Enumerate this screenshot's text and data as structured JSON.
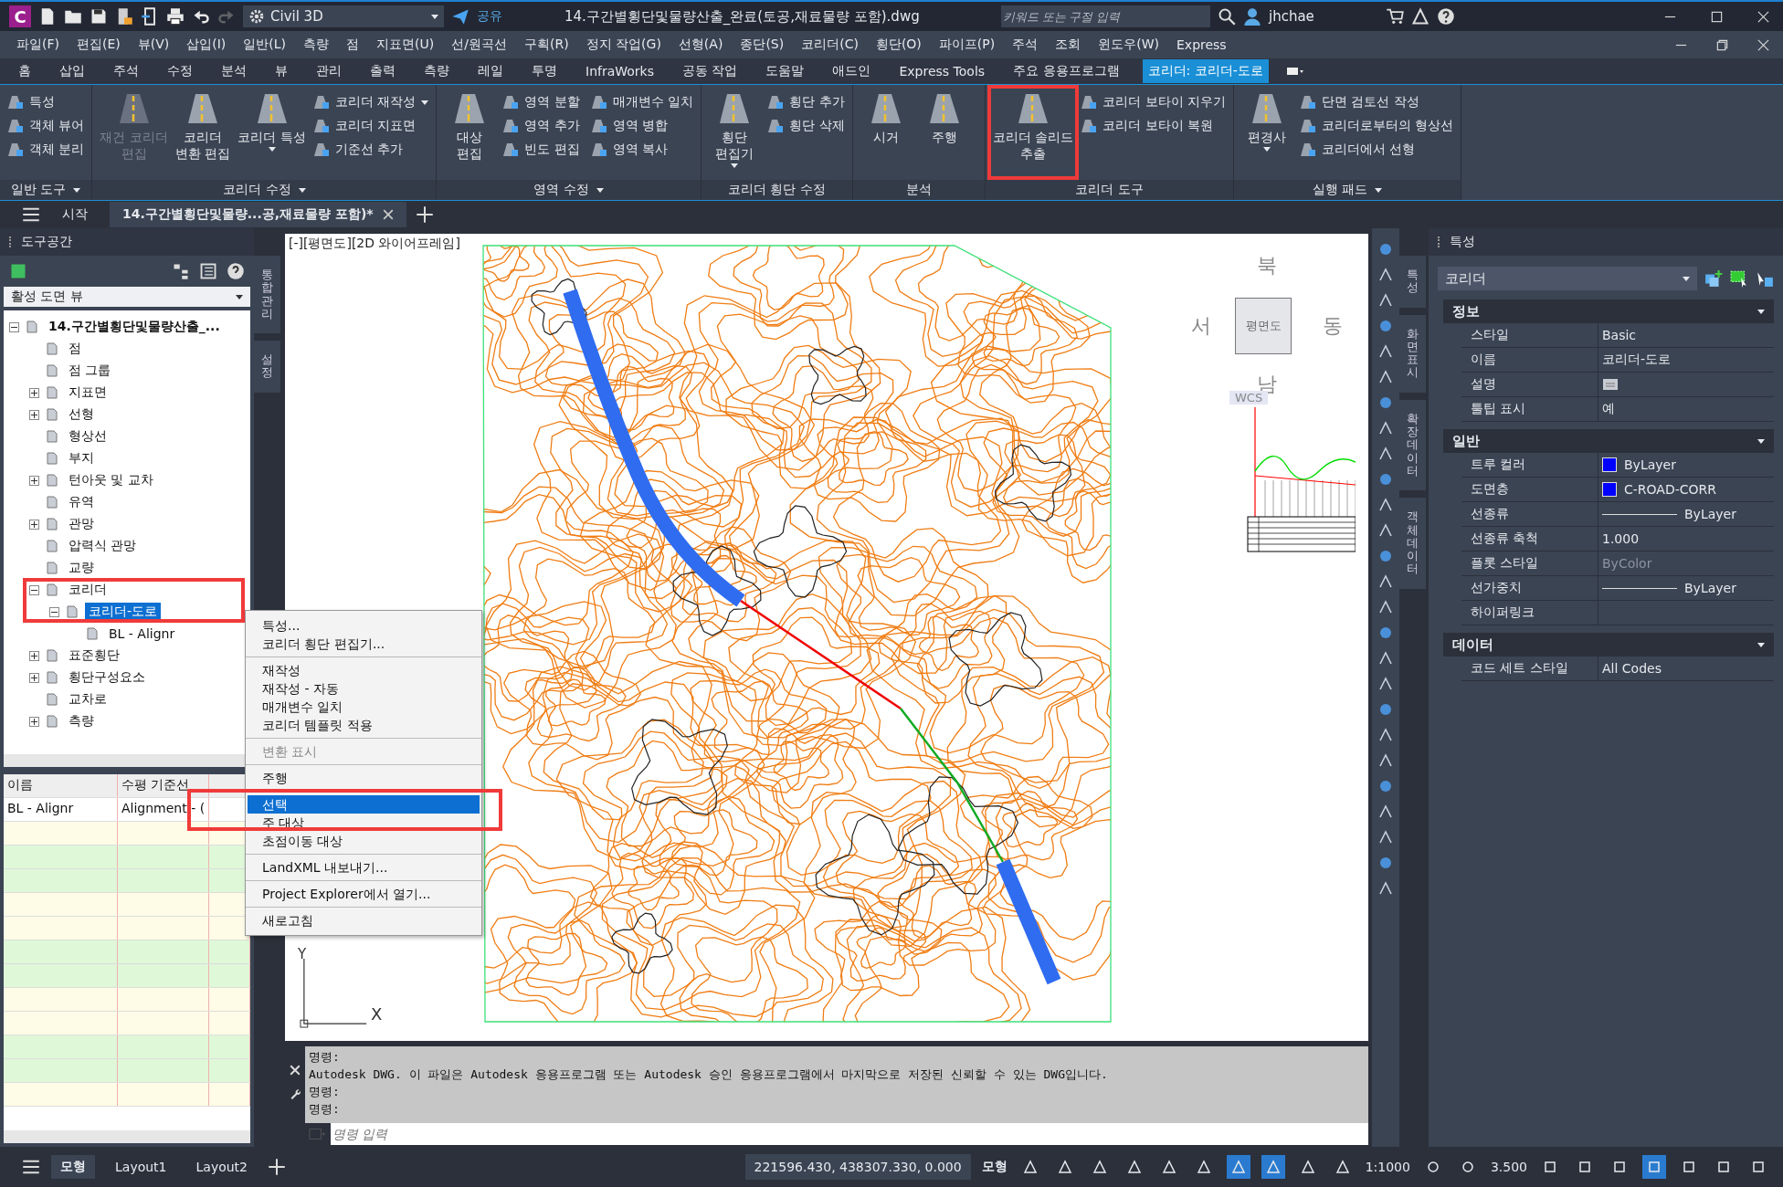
{
  "title_bar": {
    "logo": "C",
    "workspace": "Civil 3D",
    "share": "공유",
    "file_title": "14.구간별횡단및물량산출_완료(토공,재료물량 포함).dwg",
    "search": {
      "placeholder": "키워드 또는 구절 입력"
    },
    "user": "jhchae"
  },
  "menu_bar": [
    "파일(F)",
    "편집(E)",
    "뷰(V)",
    "삽입(I)",
    "일반(L)",
    "측량",
    "점",
    "지표면(U)",
    "선/원곡선",
    "구획(R)",
    "정지 작업(G)",
    "선형(A)",
    "종단(S)",
    "코리더(C)",
    "횡단(O)",
    "파이프(P)",
    "주석",
    "조회",
    "윈도우(W)",
    "Express"
  ],
  "ribbon_tabs": [
    {
      "label": "홈",
      "selected": false
    },
    {
      "label": "삽입",
      "selected": false
    },
    {
      "label": "주석",
      "selected": false
    },
    {
      "label": "수정",
      "selected": false
    },
    {
      "label": "분석",
      "selected": false
    },
    {
      "label": "뷰",
      "selected": false
    },
    {
      "label": "관리",
      "selected": false
    },
    {
      "label": "출력",
      "selected": false
    },
    {
      "label": "측량",
      "selected": false
    },
    {
      "label": "레일",
      "selected": false
    },
    {
      "label": "투명",
      "selected": false
    },
    {
      "label": "InfraWorks",
      "selected": false
    },
    {
      "label": "공동 작업",
      "selected": false
    },
    {
      "label": "도움말",
      "selected": false
    },
    {
      "label": "애드인",
      "selected": false
    },
    {
      "label": "Express Tools",
      "selected": false
    },
    {
      "label": "주요 응용프로그램",
      "selected": false
    },
    {
      "label": "코리더: 코리더-도로",
      "selected": true
    }
  ],
  "ribbon_panels": [
    {
      "title": "일반 도구",
      "has_menu": true,
      "tools": [
        {
          "label": "특성",
          "kind": "small",
          "disabled": false,
          "dropdown": false
        },
        {
          "label": "객체 뷰어",
          "kind": "small",
          "disabled": false,
          "dropdown": false
        },
        {
          "label": "객체 분리",
          "kind": "small",
          "disabled": false,
          "dropdown": false
        }
      ]
    },
    {
      "title": "코리더 수정",
      "has_menu": true,
      "tools": [
        {
          "label": "재건 코리더\n편집",
          "kind": "large",
          "disabled": true,
          "dropdown": false
        },
        {
          "label": "코리더\n변환 편집",
          "kind": "large",
          "disabled": false,
          "dropdown": false
        },
        {
          "label": "코리더 특성",
          "kind": "large",
          "disabled": false,
          "dropdown": true
        },
        {
          "label": "코리더 재작성",
          "kind": "small",
          "disabled": false,
          "dropdown": true
        },
        {
          "label": "코리더 지표면",
          "kind": "small",
          "disabled": false,
          "dropdown": false
        },
        {
          "label": "기준선 추가",
          "kind": "small",
          "disabled": false,
          "dropdown": false
        }
      ]
    },
    {
      "title": "영역 수정",
      "has_menu": true,
      "tools": [
        {
          "label": "대상\n편집",
          "kind": "large",
          "disabled": false,
          "dropdown": false
        },
        {
          "label": "영역 분할",
          "kind": "small",
          "disabled": false,
          "dropdown": false
        },
        {
          "label": "영역 추가",
          "kind": "small",
          "disabled": false,
          "dropdown": false
        },
        {
          "label": "빈도 편집",
          "kind": "small",
          "disabled": false,
          "dropdown": false
        },
        {
          "label": "매개변수 일치",
          "kind": "small",
          "disabled": false,
          "dropdown": false
        },
        {
          "label": "영역 병합",
          "kind": "small",
          "disabled": false,
          "dropdown": false
        },
        {
          "label": "영역 복사",
          "kind": "small",
          "disabled": false,
          "dropdown": false
        }
      ]
    },
    {
      "title": "코리더 횡단 수정",
      "has_menu": false,
      "tools": [
        {
          "label": "횡단\n편집기",
          "kind": "large",
          "disabled": false,
          "dropdown": true
        },
        {
          "label": "횡단 추가",
          "kind": "small",
          "disabled": false,
          "dropdown": false
        },
        {
          "label": "횡단 삭제",
          "kind": "small",
          "disabled": false,
          "dropdown": false
        }
      ]
    },
    {
      "title": "분석",
      "has_menu": false,
      "tools": [
        {
          "label": "시거",
          "kind": "large",
          "disabled": false,
          "dropdown": false
        },
        {
          "label": "주행",
          "kind": "large",
          "disabled": false,
          "dropdown": false
        }
      ]
    },
    {
      "title": "코리더 도구",
      "has_menu": false,
      "tools": [
        {
          "label": "코리더 솔리드\n추출",
          "kind": "large",
          "disabled": false,
          "dropdown": false
        },
        {
          "label": "코리더 보타이 지우기",
          "kind": "small",
          "disabled": false,
          "dropdown": false
        },
        {
          "label": "코리더 보타이 복원",
          "kind": "small",
          "disabled": false,
          "dropdown": false
        }
      ]
    },
    {
      "title": "실행 패드",
      "has_menu": true,
      "tools": [
        {
          "label": "편경사",
          "kind": "large",
          "disabled": false,
          "dropdown": true
        },
        {
          "label": "단면 검토선 작성",
          "kind": "small",
          "disabled": false,
          "dropdown": false
        },
        {
          "label": "코리더로부터의 형상선",
          "kind": "small",
          "disabled": false,
          "dropdown": false
        },
        {
          "label": "코리더에서 선형",
          "kind": "small",
          "disabled": false,
          "dropdown": false
        }
      ]
    }
  ],
  "doc_tabs": [
    {
      "label": "시작",
      "selected": false
    },
    {
      "label": "14.구간별횡단및물량...공,재료물량 포함)*",
      "selected": true
    }
  ],
  "toolspace": {
    "title": "도구공간",
    "view": "활성 도면 뷰",
    "side_tabs": [
      "통합관리",
      "설정"
    ],
    "tree": [
      {
        "label": "14.구간별횡단및물량산출_...",
        "expandable": true,
        "expanded": true,
        "selected": false,
        "children": [
          {
            "label": "점",
            "expandable": false,
            "expanded": false,
            "selected": false
          },
          {
            "label": "점 그룹",
            "expandable": false,
            "expanded": false,
            "selected": false
          },
          {
            "label": "지표면",
            "expandable": true,
            "expanded": false,
            "selected": false
          },
          {
            "label": "선형",
            "expandable": true,
            "expanded": false,
            "selected": false
          },
          {
            "label": "형상선",
            "expandable": false,
            "expanded": false,
            "selected": false
          },
          {
            "label": "부지",
            "expandable": false,
            "expanded": false,
            "selected": false
          },
          {
            "label": "턴아웃 및 교차",
            "expandable": true,
            "expanded": false,
            "selected": false
          },
          {
            "label": "유역",
            "expandable": false,
            "expanded": false,
            "selected": false
          },
          {
            "label": "관망",
            "expandable": true,
            "expanded": false,
            "selected": false
          },
          {
            "label": "압력식 관망",
            "expandable": false,
            "expanded": false,
            "selected": false
          },
          {
            "label": "교량",
            "expandable": false,
            "expanded": false,
            "selected": false
          },
          {
            "label": "코리더",
            "expandable": true,
            "expanded": true,
            "selected": false,
            "children": [
              {
                "label": "코리더-도로",
                "expandable": true,
                "expanded": true,
                "selected": true,
                "children": [
                  {
                    "label": "BL - Alignr",
                    "expandable": false,
                    "expanded": false,
                    "selected": false
                  }
                ]
              }
            ]
          },
          {
            "label": "표준횡단",
            "expandable": true,
            "expanded": false,
            "selected": false
          },
          {
            "label": "횡단구성요소",
            "expandable": true,
            "expanded": false,
            "selected": false
          },
          {
            "label": "교차로",
            "expandable": false,
            "expanded": false,
            "selected": false
          },
          {
            "label": "측량",
            "expandable": true,
            "expanded": false,
            "selected": false
          }
        ]
      }
    ],
    "list": {
      "columns": [
        "이름",
        "수평 기준선"
      ],
      "rows": [
        [
          "BL - Alignr",
          "Alignment - ("
        ]
      ]
    }
  },
  "context_menu": [
    [
      {
        "label": "특성...",
        "disabled": false,
        "selected": false
      },
      {
        "label": "코리더 횡단 편집기...",
        "disabled": false,
        "selected": false
      }
    ],
    [
      {
        "label": "재작성",
        "disabled": false,
        "selected": false
      },
      {
        "label": "재작성 - 자동",
        "disabled": false,
        "selected": false
      },
      {
        "label": "매개변수 일치",
        "disabled": false,
        "selected": false
      },
      {
        "label": "코리더 템플릿 적용",
        "disabled": false,
        "selected": false
      }
    ],
    [
      {
        "label": "변환 표시",
        "disabled": true,
        "selected": false
      }
    ],
    [
      {
        "label": "주행",
        "disabled": false,
        "selected": false
      }
    ],
    [
      {
        "label": "선택",
        "disabled": false,
        "selected": true
      },
      {
        "label": "주 대상",
        "disabled": false,
        "selected": false
      },
      {
        "label": "초점이동 대상",
        "disabled": false,
        "selected": false
      }
    ],
    [
      {
        "label": "LandXML 내보내기...",
        "disabled": false,
        "selected": false
      }
    ],
    [
      {
        "label": "Project Explorer에서 열기...",
        "disabled": false,
        "selected": false
      }
    ],
    [
      {
        "label": "새로고침",
        "disabled": false,
        "selected": false
      }
    ]
  ],
  "viewport": {
    "label": "[-][평면도][2D 와이어프레임]",
    "compass": {
      "north": "북",
      "west": "서",
      "east": "동",
      "south": "남"
    },
    "cube_face": "평면도",
    "ucs": "WCS",
    "axis_y": "Y",
    "axis_x": "X"
  },
  "command_line": {
    "history": [
      "명령:",
      "Autodesk DWG.  이 파일은 Autodesk 응용프로그램 또는 Autodesk 승인 응용프로그램에서 마지막으로 저장된 신뢰할 수 있는 DWG입니다.",
      "명령:",
      "명령:"
    ],
    "placeholder": "명령 입력"
  },
  "properties": {
    "title": "특성",
    "object": "코리더",
    "side_tabs": [
      "특성",
      "화면표시",
      "확장 데이터",
      "객체 데이터"
    ],
    "sections": [
      {
        "title": "정보",
        "rows": [
          {
            "label": "스타일",
            "value": "Basic",
            "kind": "text"
          },
          {
            "label": "이름",
            "value": "코리더-도로",
            "kind": "text"
          },
          {
            "label": "설명",
            "kind": "icon"
          },
          {
            "label": "툴팁 표시",
            "value": "예",
            "kind": "text"
          }
        ]
      },
      {
        "title": "일반",
        "rows": [
          {
            "label": "트루 컬러",
            "value": "ByLayer",
            "kind": "swatch",
            "color": "#0000ff"
          },
          {
            "label": "도면층",
            "value": "C-ROAD-CORR",
            "kind": "swatch",
            "color": "#0000ff"
          },
          {
            "label": "선종류",
            "value": "ByLayer",
            "kind": "line"
          },
          {
            "label": "선종류 축척",
            "value": "1.000",
            "kind": "text"
          },
          {
            "label": "플롯 스타일",
            "value": "ByColor",
            "kind": "muted"
          },
          {
            "label": "선가중치",
            "value": "ByLayer",
            "kind": "line"
          },
          {
            "label": "하이퍼링크",
            "kind": "empty"
          }
        ]
      },
      {
        "title": "데이터",
        "rows": [
          {
            "label": "코드 세트 스타일",
            "value": "All Codes",
            "kind": "text"
          }
        ]
      }
    ]
  },
  "status_bar": {
    "layouts": [
      {
        "label": "모형",
        "selected": true
      },
      {
        "label": "Layout1",
        "selected": false
      },
      {
        "label": "Layout2",
        "selected": false
      }
    ],
    "coords": "221596.430, 438307.330, 0.000",
    "space": "모형",
    "toggles": [
      {
        "on": false
      },
      {
        "on": false
      },
      {
        "on": false
      },
      {
        "on": false
      },
      {
        "on": false
      },
      {
        "on": false
      },
      {
        "on": true
      },
      {
        "on": true
      },
      {
        "on": false
      },
      {
        "on": false
      }
    ],
    "scale": "1:1000",
    "annotation": "3.500",
    "toggles_right": [
      {
        "on": false
      },
      {
        "on": false
      },
      {
        "on": false
      },
      {
        "on": false
      },
      {
        "on": false
      },
      {
        "on": true
      },
      {
        "on": false
      },
      {
        "on": false
      },
      {
        "on": false
      }
    ]
  }
}
